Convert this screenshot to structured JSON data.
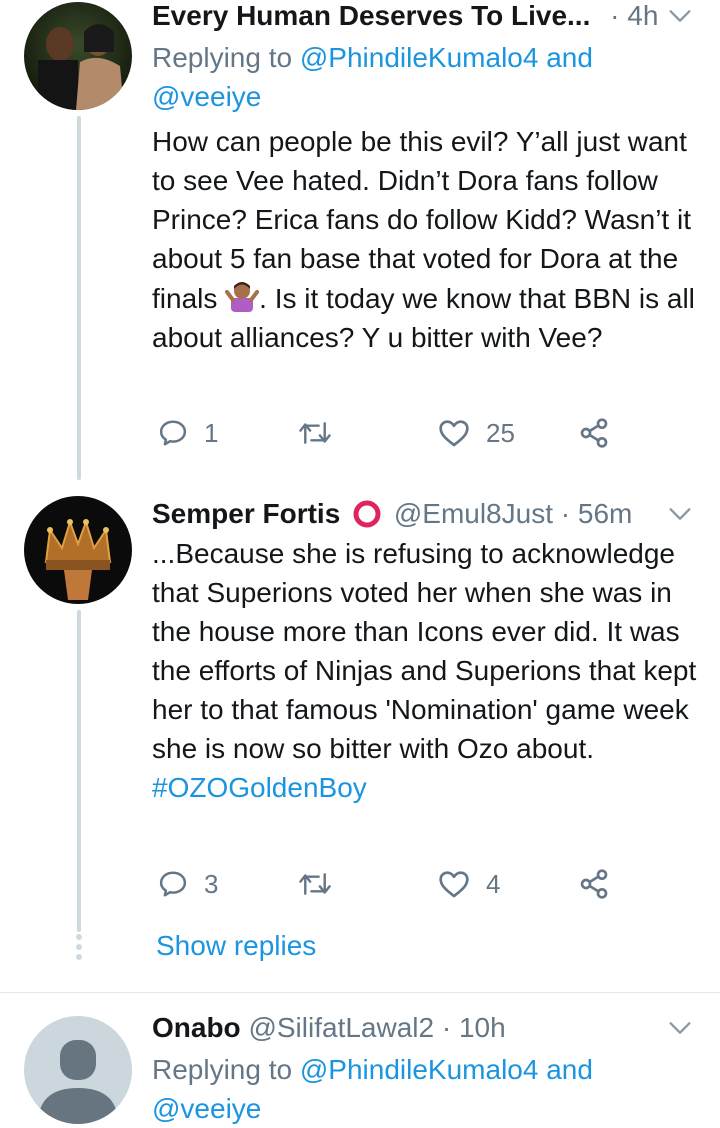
{
  "tweets": [
    {
      "name": "Every Human Deserves To Live...",
      "time": "4h",
      "replying_prefix": "Replying to",
      "replying_user1": "@PhindileKumalo4",
      "replying_and": "and",
      "replying_user2": "@veeiye",
      "text_part1": "How can people be this evil? Y’all just want to see Vee hated. Didn’t Dora fans follow Prince? Erica fans do follow Kidd? Wasn’t it about 5 fan base that voted for Dora at the finals",
      "text_emoji": "shrugging-woman-emoji",
      "text_part2": ". Is it today we know that BBN is all about alliances? Y u bitter with Vee?",
      "replies": "1",
      "retweets": "",
      "likes": "25"
    },
    {
      "name": "Semper Fortis",
      "name_badge": "red-circle-emoji",
      "handle": "@Emul8Just",
      "time": "56m",
      "text": "...Because she is refusing to acknowledge that Superions voted her when she was in the house more than Icons ever did. It was the efforts of Ninjas and Superions that kept her to that famous 'Nomination' game week she is now so bitter with Ozo about.",
      "hashtag": "#OZOGoldenBoy",
      "replies": "3",
      "retweets": "",
      "likes": "4"
    },
    {
      "name": "Onabo",
      "handle": "@SilifatLawal2",
      "time": "10h",
      "replying_prefix": "Replying to",
      "replying_user1": "@PhindileKumalo4",
      "replying_and": "and",
      "replying_user2": "@veeiye"
    }
  ],
  "show_replies_label": "Show replies",
  "separator": "·",
  "colors": {
    "link": "#1b95e0",
    "muted": "#657786",
    "text": "#14171a",
    "thread_line": "#cfd9de",
    "badge_red": "#e0245e"
  },
  "icons": [
    "reply-icon",
    "retweet-icon",
    "like-icon",
    "share-icon",
    "chevron-down-icon"
  ]
}
